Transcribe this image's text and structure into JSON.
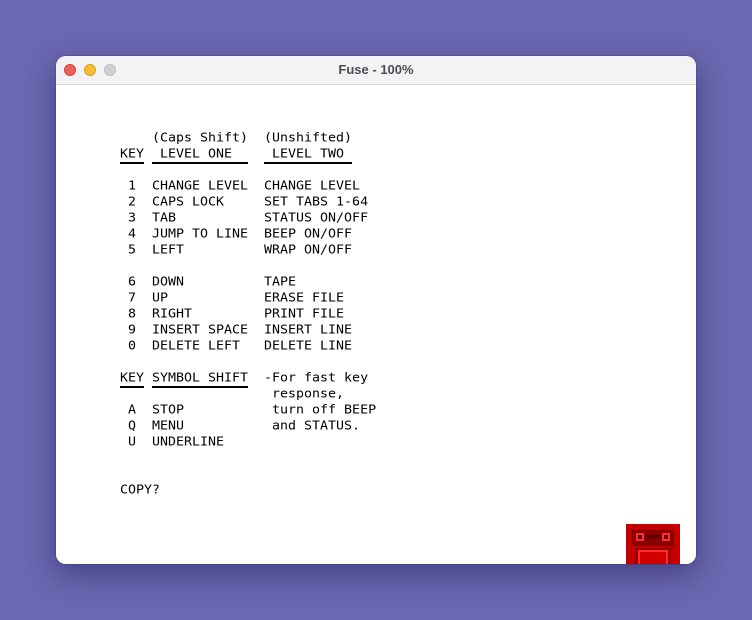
{
  "window": {
    "title": "Fuse - 100%"
  },
  "screen": {
    "header": {
      "caps_shift": "(Caps Shift)",
      "unshifted": "(Unshifted)",
      "key": "KEY",
      "level_one": "LEVEL ONE",
      "level_two": "LEVEL TWO"
    },
    "rows": [
      {
        "key": "1",
        "level_one": "CHANGE LEVEL",
        "level_two": "CHANGE LEVEL"
      },
      {
        "key": "2",
        "level_one": "CAPS LOCK",
        "level_two": "SET TABS 1-64"
      },
      {
        "key": "3",
        "level_one": "TAB",
        "level_two": "STATUS ON/OFF"
      },
      {
        "key": "4",
        "level_one": "JUMP TO LINE",
        "level_two": "BEEP ON/OFF"
      },
      {
        "key": "5",
        "level_one": "LEFT",
        "level_two": "WRAP ON/OFF"
      },
      {
        "key": "6",
        "level_one": "DOWN",
        "level_two": "TAPE"
      },
      {
        "key": "7",
        "level_one": "UP",
        "level_two": "ERASE FILE"
      },
      {
        "key": "8",
        "level_one": "RIGHT",
        "level_two": "PRINT FILE"
      },
      {
        "key": "9",
        "level_one": "INSERT SPACE",
        "level_two": "INSERT LINE"
      },
      {
        "key": "0",
        "level_one": "DELETE LEFT",
        "level_two": "DELETE LINE"
      }
    ],
    "symbol_header": {
      "key": "KEY",
      "symbol_shift": "SYMBOL SHIFT"
    },
    "note": [
      "-For fast key",
      " response,",
      " turn off BEEP",
      " and STATUS."
    ],
    "symbol_rows": [
      {
        "key": "A",
        "label": "STOP"
      },
      {
        "key": "Q",
        "label": "MENU"
      },
      {
        "key": "U",
        "label": "UNDERLINE"
      }
    ],
    "prompt": "COPY?"
  },
  "icons": {
    "tape_indicator": "cassette-tape-icon"
  },
  "colors": {
    "desktop": "#6b67b0",
    "tape_indicator": "#c20000"
  }
}
